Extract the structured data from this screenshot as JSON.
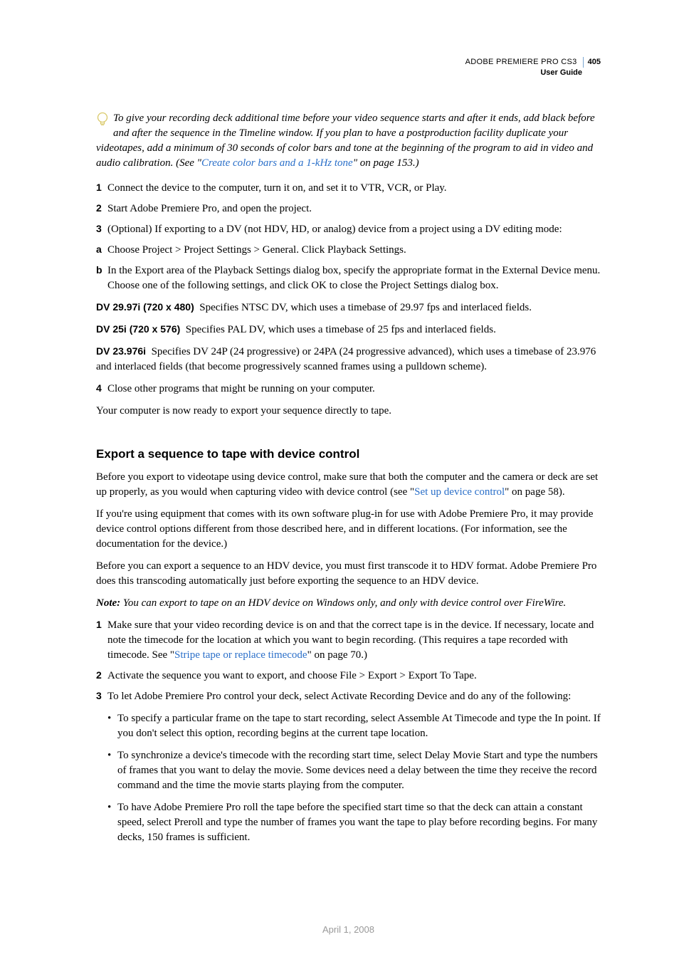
{
  "header": {
    "product": "ADOBE PREMIERE PRO CS3",
    "page_num": "405",
    "subtitle": "User Guide"
  },
  "tip": {
    "text_before_link": "To give your recording deck additional time before your video sequence starts and after it ends, add black before and after the sequence in the Timeline window. If you plan to have a postproduction facility duplicate your videotapes, add a minimum of 30 seconds of color bars and tone at the beginning of the program to aid in video and audio calibration. (See \"",
    "link_text": "Create color bars and a 1-kHz tone",
    "text_after_link": "\" on page 153.)"
  },
  "steps1": [
    {
      "n": "1",
      "t": "Connect the device to the computer, turn it on, and set it to VTR, VCR, or Play."
    },
    {
      "n": "2",
      "t": "Start Adobe Premiere Pro, and open the project."
    },
    {
      "n": "3",
      "t": "(Optional) If exporting to a DV (not HDV, HD, or analog) device from a project using a DV editing mode:"
    },
    {
      "n": "a",
      "t": "Choose Project > Project Settings > General. Click Playback Settings."
    },
    {
      "n": "b",
      "t": "In the Export area of the Playback Settings dialog box, specify the appropriate format in the External Device menu. Choose one of the following settings, and click OK to close the Project Settings dialog box."
    }
  ],
  "defs": [
    {
      "term": "DV 29.97i (720 x 480)",
      "body": "Specifies NTSC DV, which uses a timebase of 29.97 fps and interlaced fields."
    },
    {
      "term": "DV 25i (720 x 576)",
      "body": "Specifies PAL DV, which uses a timebase of 25 fps and interlaced fields."
    },
    {
      "term": "DV 23.976i",
      "body": "Specifies DV 24P (24 progressive) or 24PA (24 progressive advanced), which uses a timebase of 23.976 and interlaced fields (that become progressively scanned frames using a pulldown scheme)."
    }
  ],
  "step4": {
    "n": "4",
    "t": "Close other programs that might be running on your computer."
  },
  "p_ready": "Your computer is now ready to export your sequence directly to tape.",
  "section2": {
    "heading": "Export a sequence to tape with device control",
    "p1_before": "Before you export to videotape using device control, make sure that both the computer and the camera or deck are set up properly, as you would when capturing video with device control (see \"",
    "p1_link": "Set up device control",
    "p1_after": "\" on page 58).",
    "p2": "If you're using equipment that comes with its own software plug-in for use with Adobe Premiere Pro, it may provide device control options different from those described here, and in different locations. (For information, see the documentation for the device.)",
    "p3": "Before you can export a sequence to an HDV device, you must first transcode it to HDV format. Adobe Premiere Pro does this transcoding automatically just before exporting the sequence to an HDV device.",
    "note_label": "Note:",
    "note_text": " You can export to tape on an HDV device on Windows only, and only with device control over FireWire.",
    "step1_n": "1",
    "step1_before": "Make sure that your video recording device is on and that the correct tape is in the device. If necessary, locate and note the timecode for the location at which you want to begin recording. (This requires a tape recorded with timecode. See \"",
    "step1_link": "Stripe tape or replace timecode",
    "step1_after": "\" on page 70.)",
    "step2": {
      "n": "2",
      "t": "Activate the sequence you want to export, and choose File > Export > Export To Tape."
    },
    "step3": {
      "n": "3",
      "t": "To let Adobe Premiere Pro control your deck, select Activate Recording Device and do any of the following:"
    },
    "bullets": [
      "To specify a particular frame on the tape to start recording, select Assemble At Timecode and type the In point. If you don't select this option, recording begins at the current tape location.",
      "To synchronize a device's timecode with the recording start time, select Delay Movie Start and type the numbers of frames that you want to delay the movie. Some devices need a delay between the time they receive the record command and the time the movie starts playing from the computer.",
      "To have Adobe Premiere Pro roll the tape before the specified start time so that the deck can attain a constant speed, select Preroll and type the number of frames you want the tape to play before recording begins. For many decks, 150 frames is sufficient."
    ]
  },
  "footer_date": "April 1, 2008"
}
